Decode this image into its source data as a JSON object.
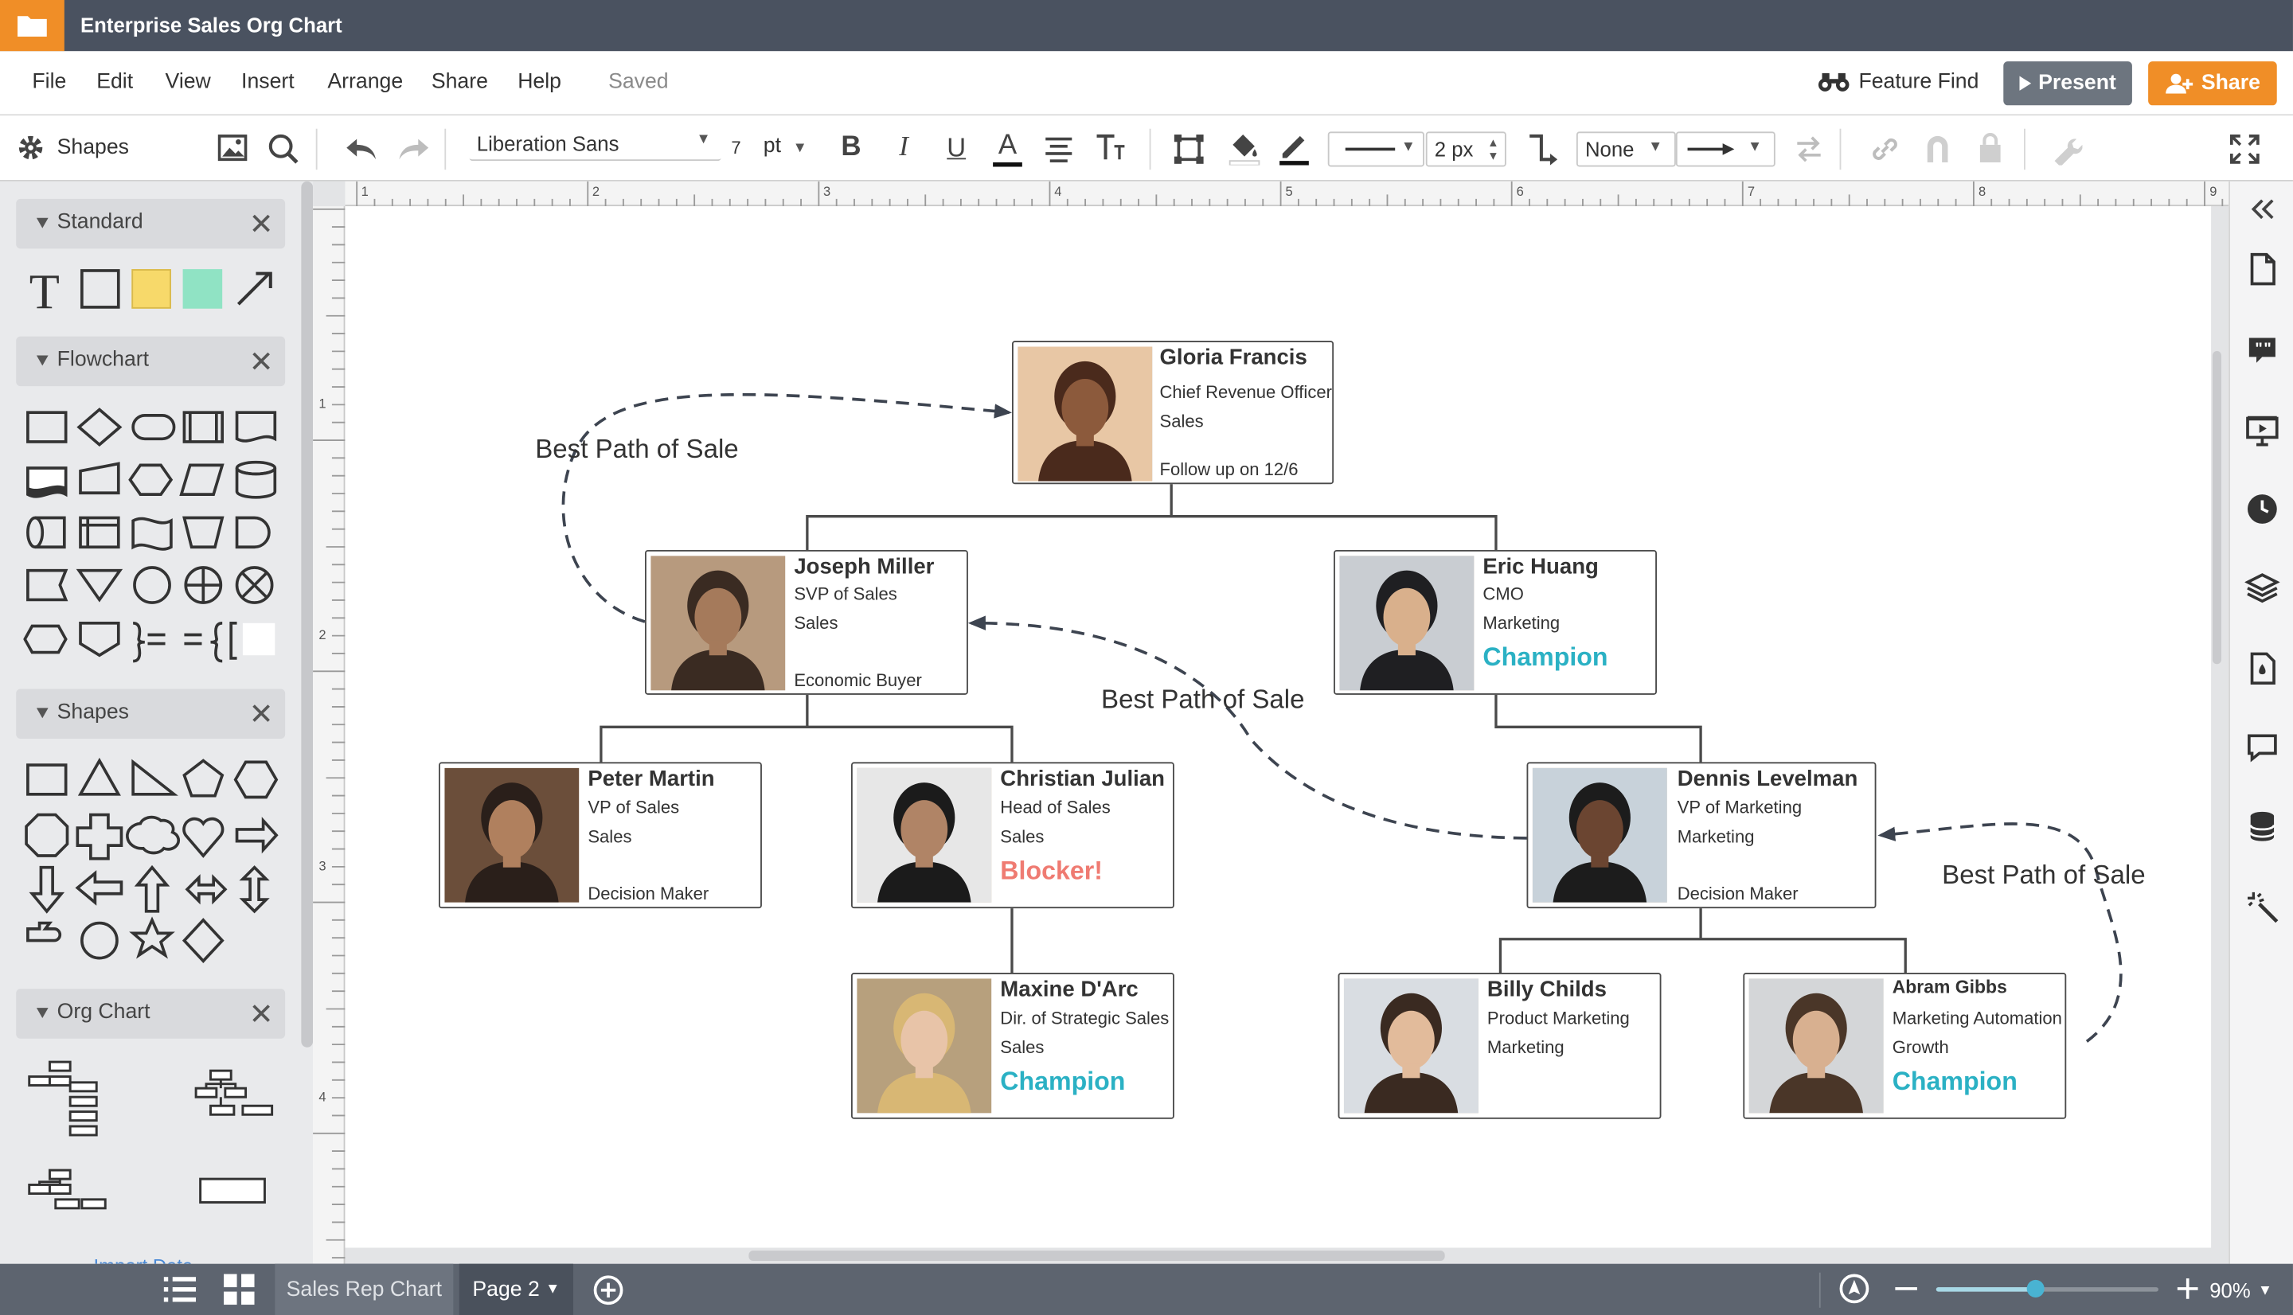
{
  "app": {
    "title": "Enterprise Sales Org Chart",
    "saved_status": "Saved"
  },
  "menu": [
    "File",
    "Edit",
    "View",
    "Insert",
    "Arrange",
    "Share",
    "Help"
  ],
  "header": {
    "feature_find": "Feature Find",
    "present": "Present",
    "share": "Share"
  },
  "toolbar": {
    "shapes_label": "Shapes",
    "font_family": "Liberation Sans",
    "font_size": "7",
    "font_unit": "pt",
    "line_width": "2 px",
    "arrow_start": "None"
  },
  "sidebar": {
    "sections": [
      {
        "title": "Standard"
      },
      {
        "title": "Flowchart"
      },
      {
        "title": "Shapes"
      },
      {
        "title": "Org Chart"
      }
    ],
    "import_data": "Import Data"
  },
  "ruler": {
    "top_marks": [
      "1",
      "2",
      "3",
      "4",
      "5",
      "6",
      "7",
      "8",
      "9"
    ],
    "left_marks": [
      "1",
      "2",
      "3",
      "4"
    ]
  },
  "chart": {
    "nodes": [
      {
        "id": "gloria",
        "name": "Gloria Francis",
        "title": "Chief Revenue Officer",
        "dept": "Sales",
        "note": "Follow up on 12/6",
        "tag": ""
      },
      {
        "id": "joseph",
        "name": "Joseph Miller",
        "title": "SVP of Sales",
        "dept": "Sales",
        "note": "Economic Buyer",
        "tag": ""
      },
      {
        "id": "eric",
        "name": "Eric Huang",
        "title": "CMO",
        "dept": "Marketing",
        "note": "",
        "tag": "Champion"
      },
      {
        "id": "peter",
        "name": "Peter Martin",
        "title": "VP of Sales",
        "dept": "Sales",
        "note": "Decision Maker",
        "tag": ""
      },
      {
        "id": "christian",
        "name": "Christian Julian",
        "title": "Head of Sales",
        "dept": "Sales",
        "note": "",
        "tag": "Blocker!"
      },
      {
        "id": "dennis",
        "name": "Dennis Levelman",
        "title": "VP of Marketing",
        "dept": "Marketing",
        "note": "Decision Maker",
        "tag": ""
      },
      {
        "id": "maxine",
        "name": "Maxine D'Arc",
        "title": "Dir. of Strategic Sales",
        "dept": "Sales",
        "note": "",
        "tag": "Champion"
      },
      {
        "id": "billy",
        "name": "Billy Childs",
        "title": "Product Marketing",
        "dept": "Marketing",
        "note": "",
        "tag": ""
      },
      {
        "id": "abram",
        "name": "Abram Gibbs",
        "title": "Marketing Automation",
        "dept": "Growth",
        "note": "",
        "tag": "Champion"
      }
    ],
    "path_label": "Best Path of Sale",
    "colors": {
      "champion": "#2bb1c4",
      "blocker": "#ef7b72",
      "line": "#4a4a4a"
    }
  },
  "status": {
    "tab_sales": "Sales Rep Chart",
    "tab_page": "Page 2",
    "zoom": "90%"
  },
  "colors": {
    "titlebar": "#4a5260",
    "accent": "#f08e27",
    "present": "#6d757f",
    "statusbar": "#5d646f"
  }
}
